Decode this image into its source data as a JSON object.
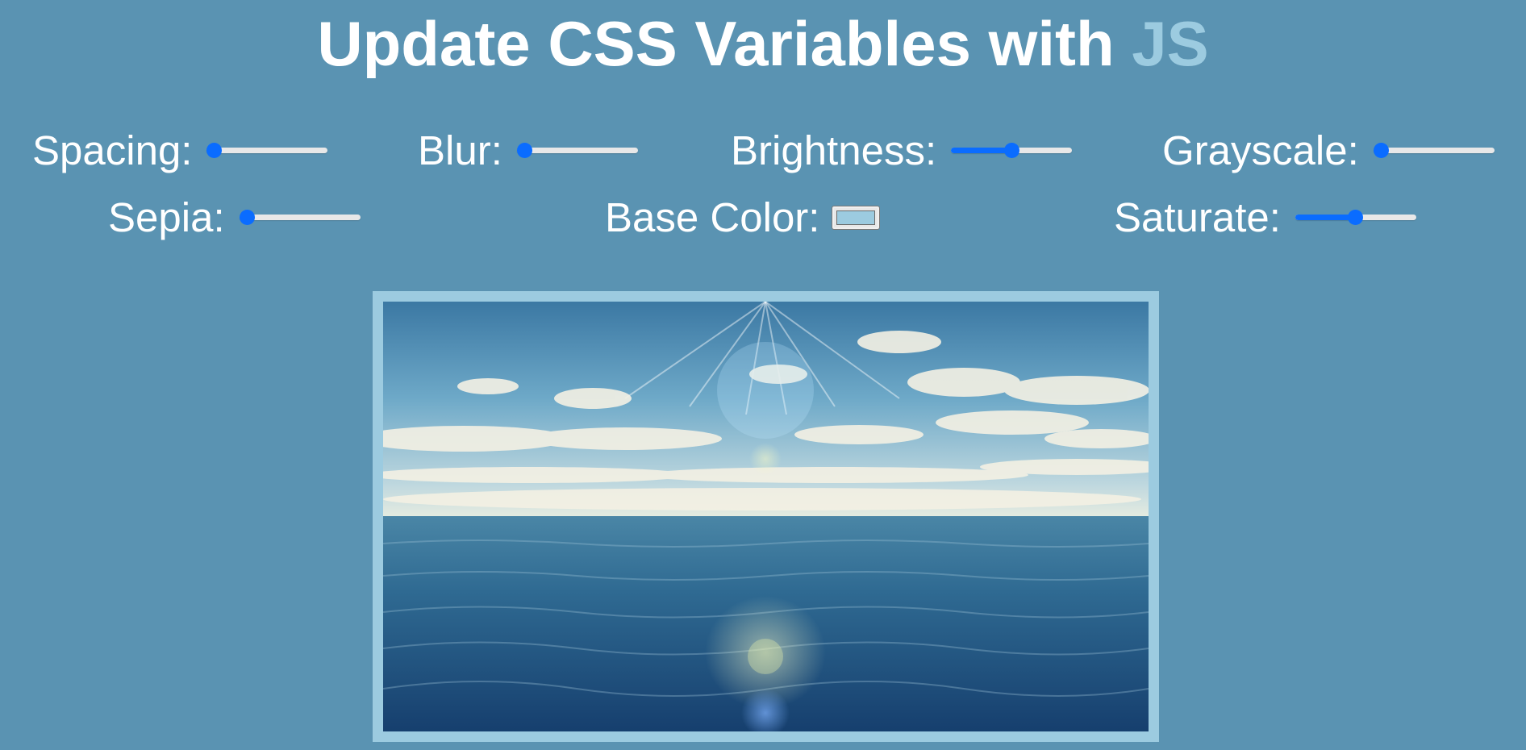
{
  "header": {
    "title_prefix": "Update CSS Variables with ",
    "title_highlight": "JS"
  },
  "controls": {
    "spacing": {
      "label": "Spacing:",
      "value_fraction": 0.0
    },
    "blur": {
      "label": "Blur:",
      "value_fraction": 0.0
    },
    "brightness": {
      "label": "Brightness:",
      "value_fraction": 0.5
    },
    "grayscale": {
      "label": "Grayscale:",
      "value_fraction": 0.0
    },
    "sepia": {
      "label": "Sepia:",
      "value_fraction": 0.0
    },
    "base_color": {
      "label": "Base Color:",
      "value": "#9ccbe0"
    },
    "saturate": {
      "label": "Saturate:",
      "value_fraction": 0.5
    }
  },
  "image": {
    "subject": "ocean-horizon-with-clouds-and-sun-rays"
  },
  "colors": {
    "background": "#5a93b2",
    "accent": "#9ccbe0",
    "slider_active": "#0a6cff",
    "slider_track": "#e8e8e8",
    "text": "#ffffff"
  }
}
